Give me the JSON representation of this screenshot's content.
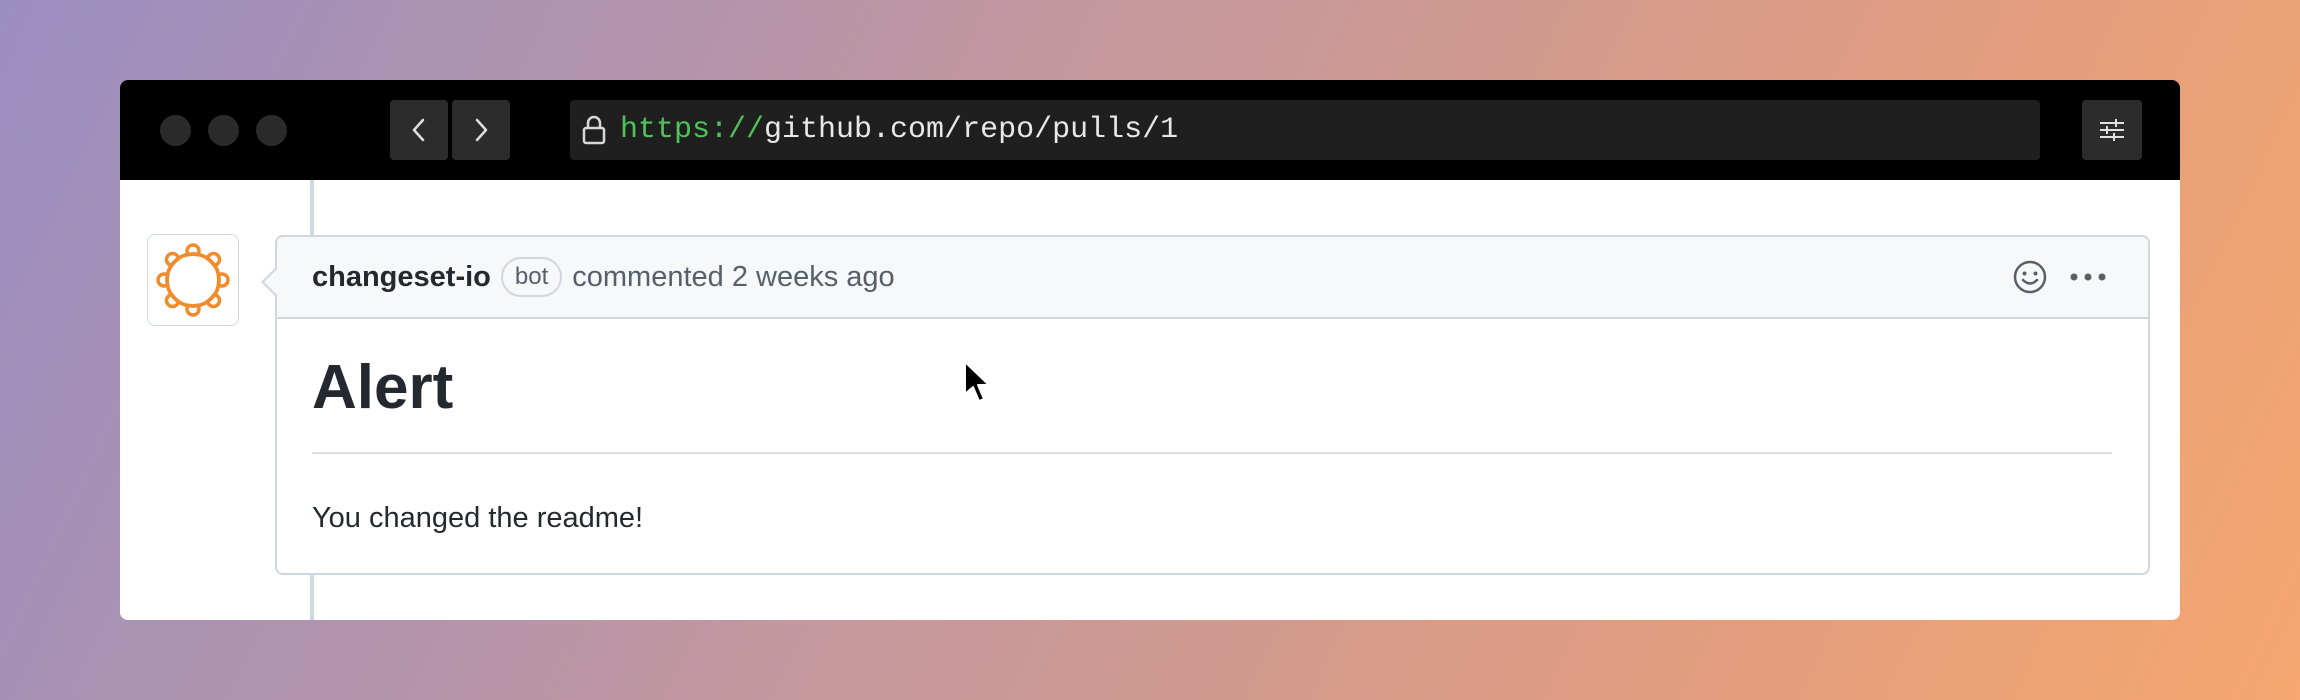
{
  "browser": {
    "url_scheme": "https://",
    "url_rest": "github.com/repo/pulls/1",
    "icons": {
      "back": "chevron-left-icon",
      "forward": "chevron-right-icon",
      "lock": "lock-icon",
      "settings": "sliders-icon"
    }
  },
  "comment": {
    "author": "changeset-io",
    "badge": "bot",
    "meta": "commented 2 weeks ago",
    "title": "Alert",
    "body": "You changed the readme!",
    "icons": {
      "reaction": "smiley-icon",
      "menu": "kebab-horizontal-icon"
    }
  },
  "colors": {
    "accent_url": "#4fc35a",
    "avatar_orange": "#f08c2b"
  }
}
